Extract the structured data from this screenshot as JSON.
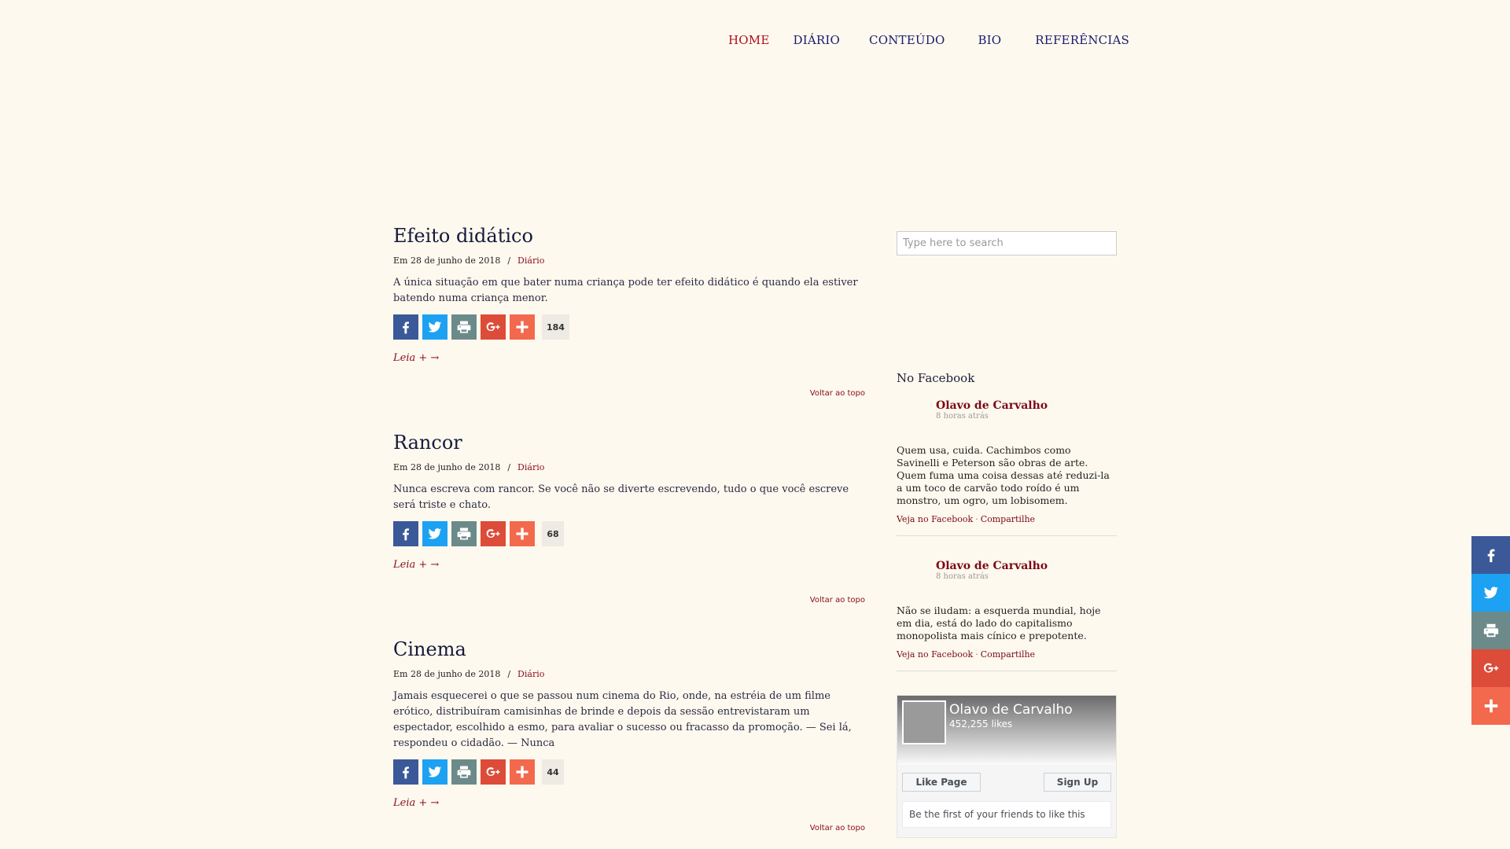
{
  "nav": {
    "items": [
      {
        "label": "HOME",
        "active": true
      },
      {
        "label": "DIÁRIO"
      },
      {
        "label": "CONTEÚDO"
      },
      {
        "label": "BIO"
      },
      {
        "label": "REFERÊNCIAS"
      }
    ]
  },
  "posts": [
    {
      "title": "Efeito didático",
      "date": "Em 28 de junho de 2018",
      "separator": "/",
      "category": "Diário",
      "excerpt": "A única situação em que bater numa criança pode ter efeito didático é quando ela estiver batendo numa criança menor.",
      "share_count": "184",
      "read_more": "Leia + →",
      "back_to_top": "Voltar ao topo"
    },
    {
      "title": "Rancor",
      "date": "Em 28 de junho de 2018",
      "separator": "/",
      "category": "Diário",
      "excerpt": "Nunca escreva com rancor. Se você não se diverte escrevendo, tudo o que você escreve será triste e chato.",
      "share_count": "68",
      "read_more": "Leia + →",
      "back_to_top": "Voltar ao topo"
    },
    {
      "title": "Cinema",
      "date": "Em 28 de junho de 2018",
      "separator": "/",
      "category": "Diário",
      "excerpt": "Jamais esquecerei o que se passou num cinema do Rio, onde, na estréia de um filme erótico, distribuíram camisinhas de brinde e depois da sessão entrevistaram um espectador, escolhido a esmo, para avaliar o sucesso ou fracasso da promoção. — Sei lá, respondeu o cidadão. — Nunca",
      "share_count": "44",
      "read_more": "Leia + →",
      "back_to_top": "Voltar ao topo"
    }
  ],
  "sidebar": {
    "search_placeholder": "Type here to search",
    "facebook_heading": "No Facebook",
    "fb_posts": [
      {
        "author": "Olavo de Carvalho",
        "time": "8 horas atrás",
        "text": "Quem usa, cuida. Cachimbos como Savinelli e Peterson são obras de arte. Quem fuma uma coisa dessas até reduzi-la a um toco de carvão todo roído é um monstro, um ogro, um lobisomem.",
        "link_view": "Veja no Facebook",
        "dot": "·",
        "link_share": "Compartilhe"
      },
      {
        "author": "Olavo de Carvalho",
        "time": "8 horas atrás",
        "text": "Não se iludam: a esquerda mundial, hoje em dia, está do lado do capitalismo monopolista mais cínico e prepotente.",
        "link_view": "Veja no Facebook",
        "dot": "·",
        "link_share": "Compartilhe"
      }
    ],
    "fb_widget": {
      "page_name": "Olavo de Carvalho",
      "likes": "452,255 likes",
      "like_button": "Like Page",
      "signup_button": "Sign Up",
      "friends_text": "Be the first of your friends to like this"
    }
  },
  "share_buttons": [
    "facebook-icon",
    "twitter-icon",
    "print-icon",
    "google-plus-icon",
    "add-icon"
  ],
  "colors": {
    "background": "#fef9ee",
    "nav_active": "#b00e1d",
    "nav_link": "#1a1a6e",
    "accent_link": "#8a1020",
    "facebook": "#3b5998",
    "twitter": "#1da1f2",
    "print": "#6d8a8a",
    "google_plus": "#dd4b39",
    "add": "#f2694d"
  }
}
